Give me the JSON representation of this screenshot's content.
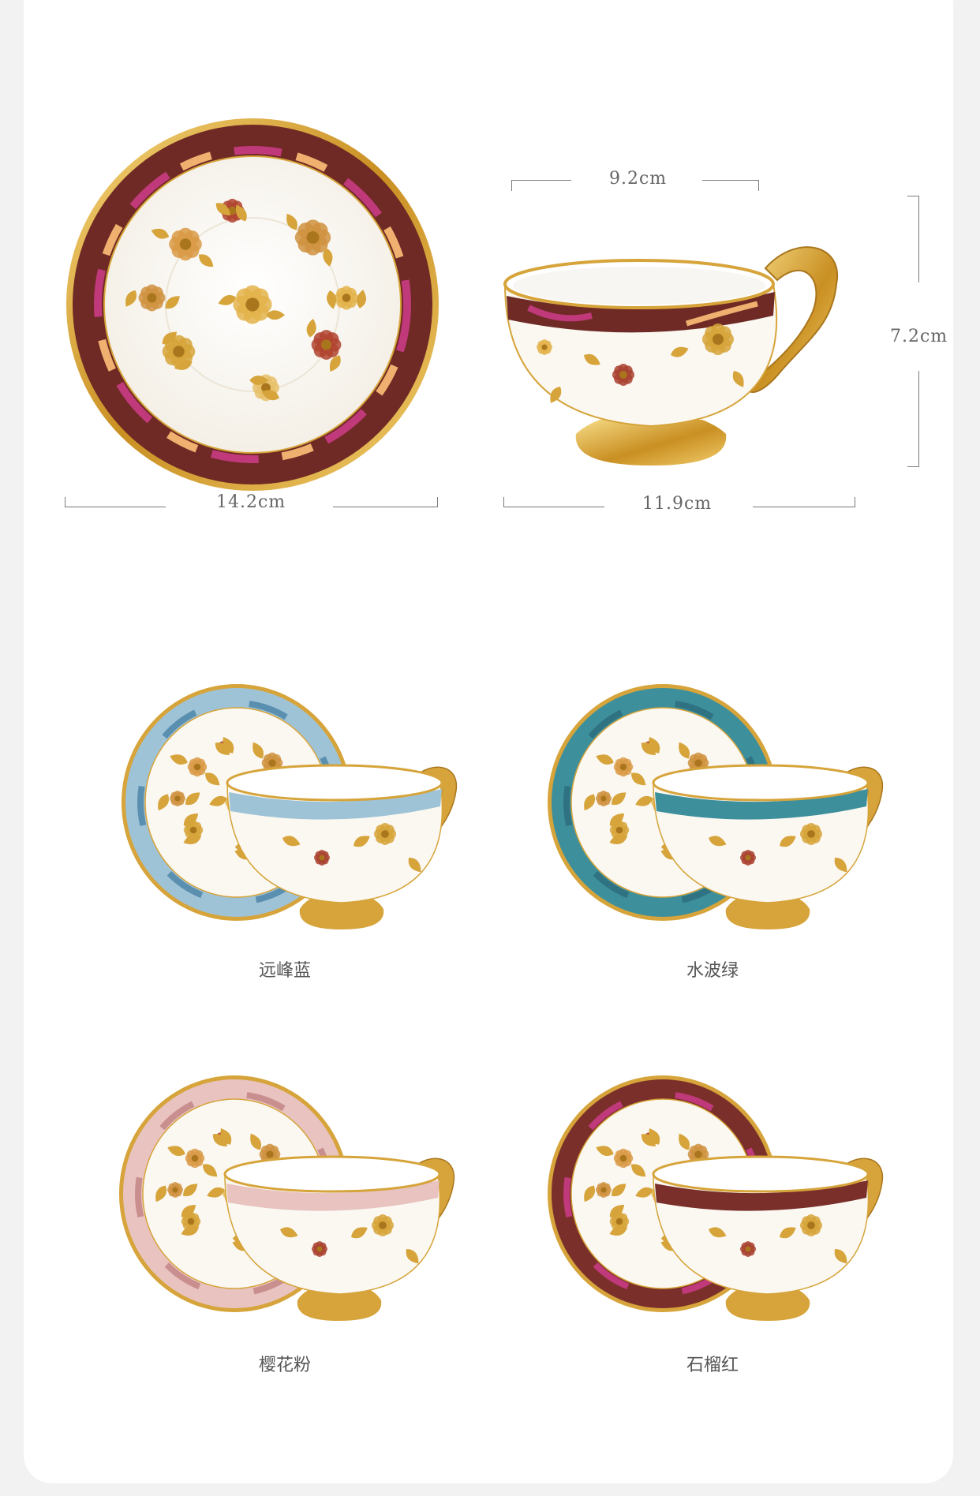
{
  "dimensions": {
    "saucer_diameter": "14.2cm",
    "cup_rim_diameter": "9.2cm",
    "cup_width_with_handle": "11.9cm",
    "cup_height": "7.2cm"
  },
  "variants": [
    {
      "label": "远峰蓝",
      "band": "#9fc3d6",
      "accent": "#5b8fb0"
    },
    {
      "label": "水波绿",
      "band": "#3e8f9c",
      "accent": "#2f7282"
    },
    {
      "label": "樱花粉",
      "band": "#e8c3c0",
      "accent": "#c98f8e"
    },
    {
      "label": "石榴红",
      "band": "#7a2f2a",
      "accent": "#c0397a"
    }
  ],
  "colors": {
    "gold": "#d6a43a",
    "gold_dark": "#a9761d",
    "pomegranate": "#6f2a25",
    "magenta": "#c0397a",
    "peach": "#f0b070",
    "porcelain": "#fbf8f2"
  }
}
